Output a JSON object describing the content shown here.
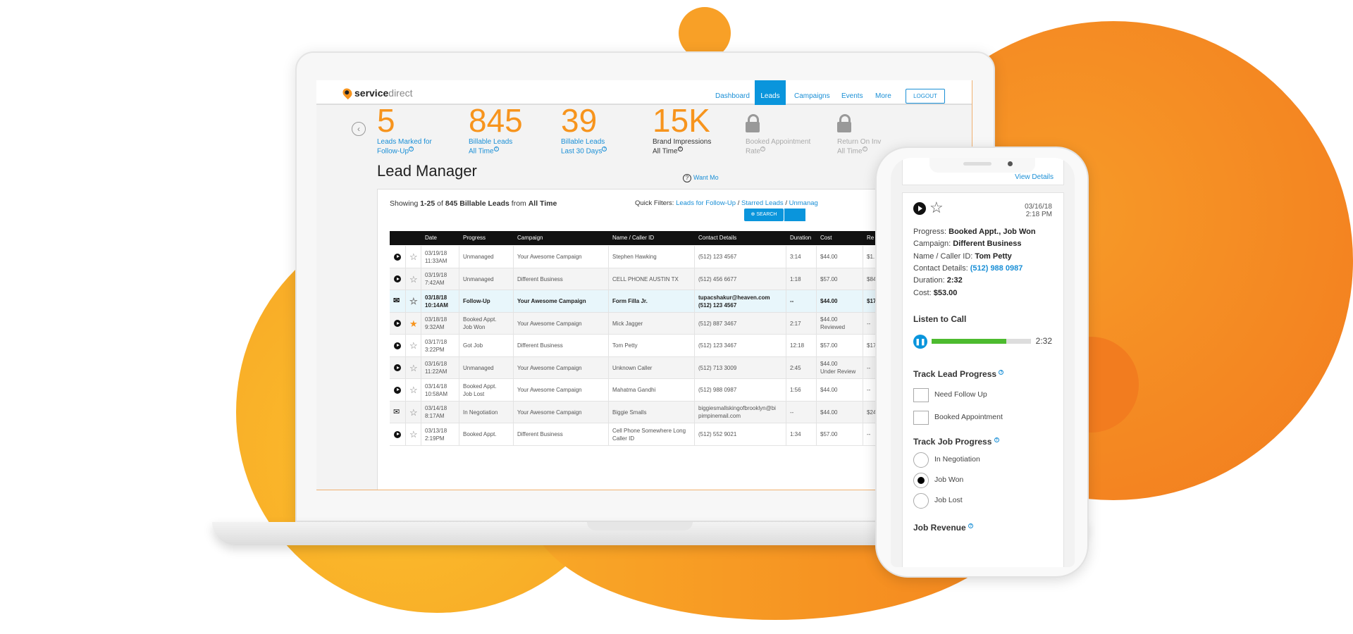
{
  "brand": {
    "name_bold": "service",
    "name_light": "direct",
    "primary": "#f7941d",
    "accent": "#0a95dc"
  },
  "nav": {
    "items": [
      "Dashboard",
      "Leads",
      "Campaigns",
      "Events",
      "More"
    ],
    "active": "Leads",
    "logout": "LOGOUT"
  },
  "stats": [
    {
      "value": "5",
      "label1": "Leads Marked for",
      "label2": "Follow-Up"
    },
    {
      "value": "845",
      "label1": "Billable Leads",
      "label2": "All Time"
    },
    {
      "value": "39",
      "label1": "Billable Leads",
      "label2": "Last 30 Days"
    },
    {
      "value": "15K",
      "label1": "Brand Impressions",
      "label2": "All Time"
    },
    {
      "value": "",
      "label1": "Booked Appointment",
      "label2": "Rate",
      "icon": "lock-icon"
    },
    {
      "value": "",
      "label1": "Return On Inv",
      "label2": "All Time",
      "icon": "lock-icon"
    }
  ],
  "lead_manager": {
    "title": "Lead Manager",
    "want_more": "Want Mo",
    "showing_pre": "Showing ",
    "showing_range": "1-25",
    "showing_of": " of ",
    "showing_count": "845 Billable Leads",
    "showing_from": " from ",
    "showing_period": "All Time",
    "quick_filters_label": "Quick Filters: ",
    "quick_filters": [
      "Leads for Follow-Up",
      "Starred Leads",
      "Unmanag"
    ],
    "search": "SEARCH"
  },
  "table": {
    "headers": [
      "",
      "",
      "Date",
      "Progress",
      "Campaign",
      "Name / Caller ID",
      "Contact Details",
      "Duration",
      "Cost",
      "Re"
    ],
    "rows": [
      {
        "type": "call",
        "starred": false,
        "date": "03/19/18",
        "time": "11:33AM",
        "progress": "Unmanaged",
        "progress2": "",
        "campaign": "Your Awesome Campaign",
        "name": "Stephen Hawking",
        "name2": "",
        "contact": "(512) 123 4567",
        "contact2": "",
        "duration": "3:14",
        "cost": "$44.00",
        "cost_note": "",
        "re": "$1."
      },
      {
        "type": "call",
        "starred": false,
        "date": "03/19/18",
        "time": "7:42AM",
        "progress": "Unmanaged",
        "progress2": "",
        "campaign": "Different Business",
        "name": "CELL PHONE AUSTIN TX",
        "name2": "",
        "contact": "(512) 456 6677",
        "contact2": "",
        "duration": "1:18",
        "cost": "$57.00",
        "cost_note": "",
        "re": "$84"
      },
      {
        "type": "email",
        "starred": false,
        "highlight": true,
        "date": "03/18/18",
        "time": "10:14AM",
        "progress": "Follow-Up",
        "progress2": "",
        "campaign": "Your Awesome Campaign",
        "name": "Form Filla Jr.",
        "name2": "",
        "contact": "tupacshakur@heaven.com",
        "contact2": "(512) 123 4567",
        "duration": "--",
        "cost": "$44.00",
        "cost_note": "",
        "re": "$17"
      },
      {
        "type": "call",
        "starred": true,
        "date": "03/18/18",
        "time": "9:32AM",
        "progress": "Booked Appt.",
        "progress2": "Job Won",
        "campaign": "Your Awesome Campaign",
        "name": "Mick Jagger",
        "name2": "",
        "contact": "(512) 887 3467",
        "contact2": "",
        "duration": "2:17",
        "cost": "$44.00",
        "cost_note": "Reviewed",
        "re": "--"
      },
      {
        "type": "call",
        "starred": false,
        "date": "03/17/18",
        "time": "3:22PM",
        "progress": "Got Job",
        "progress2": "",
        "campaign": "Different Business",
        "name": "Tom Petty",
        "name2": "",
        "contact": "(512) 123 3467",
        "contact2": "",
        "duration": "12:18",
        "cost": "$57.00",
        "cost_note": "",
        "re": "$17"
      },
      {
        "type": "call",
        "starred": false,
        "date": "03/16/18",
        "time": "11:22AM",
        "progress": "Unmanaged",
        "progress2": "",
        "campaign": "Your Awesome Campaign",
        "name": "Unknown Caller",
        "name2": "",
        "contact": "(512) 713 3009",
        "contact2": "",
        "duration": "2:45",
        "cost": "$44.00",
        "cost_note": "Under Review",
        "re": "--"
      },
      {
        "type": "call",
        "starred": false,
        "date": "03/14/18",
        "time": "10:58AM",
        "progress": "Booked Appt.",
        "progress2": "Job Lost",
        "campaign": "Your Awesome Campaign",
        "name": "Mahatma Gandhi",
        "name2": "",
        "contact": "(512) 988 0987",
        "contact2": "",
        "duration": "1:56",
        "cost": "$44.00",
        "cost_note": "",
        "re": "--"
      },
      {
        "type": "email",
        "starred": false,
        "date": "03/14/18",
        "time": "8:17AM",
        "progress": "In Negotiation",
        "progress2": "",
        "campaign": "Your Awesome Campaign",
        "name": "Biggie Smalls",
        "name2": "",
        "contact": "biggiesmallskingofbrooklyn@bi",
        "contact2": "pimpinemail.com",
        "duration": "--",
        "cost": "$44.00",
        "cost_note": "",
        "re": "$24"
      },
      {
        "type": "call",
        "starred": false,
        "date": "03/13/18",
        "time": "2:19PM",
        "progress": "Booked Appt.",
        "progress2": "",
        "campaign": "Different Business",
        "name": "Cell Phone Somewhere Long",
        "name2": "Caller ID",
        "contact": "(512) 552 9021",
        "contact2": "",
        "duration": "1:34",
        "cost": "$57.00",
        "cost_note": "",
        "re": "--"
      }
    ]
  },
  "phone": {
    "view_details": "View Details",
    "date": "03/16/18",
    "time": "2:18 PM",
    "fields": [
      {
        "label": "Progress: ",
        "value": "Booked Appt., Job Won"
      },
      {
        "label": "Campaign: ",
        "value": "Different Business"
      },
      {
        "label": "Name / Caller ID: ",
        "value": "Tom Petty"
      },
      {
        "label": "Contact Details: ",
        "value": "(512) 988 0987",
        "link": true
      },
      {
        "label": "Duration: ",
        "value": "2:32"
      },
      {
        "label": "Cost: ",
        "value": "$53.00"
      }
    ],
    "listen_title": "Listen to Call",
    "audio_progress": 0.75,
    "audio_time": "2:32",
    "track_lead_title": "Track Lead Progress",
    "lead_options": [
      {
        "label": "Need Follow Up",
        "checked": false
      },
      {
        "label": "Booked Appointment",
        "checked": false
      }
    ],
    "track_job_title": "Track Job Progress",
    "job_options": [
      {
        "label": "In Negotiation",
        "selected": false
      },
      {
        "label": "Job Won",
        "selected": true
      },
      {
        "label": "Job Lost",
        "selected": false
      }
    ],
    "job_revenue_title": "Job Revenue"
  }
}
